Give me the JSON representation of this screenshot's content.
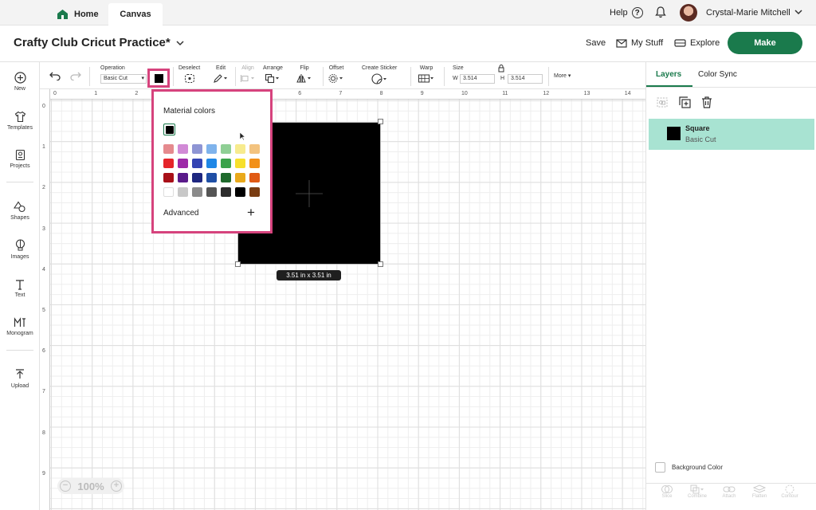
{
  "topbar": {
    "home_label": "Home",
    "canvas_label": "Canvas",
    "help_label": "Help",
    "user_name": "Crystal-Marie Mitchell"
  },
  "header": {
    "project_title": "Crafty Club Cricut Practice*",
    "save_label": "Save",
    "my_stuff_label": "My Stuff",
    "explore_label": "Explore",
    "make_label": "Make"
  },
  "leftbar": {
    "new": "New",
    "templates": "Templates",
    "projects": "Projects",
    "shapes": "Shapes",
    "images": "Images",
    "text": "Text",
    "monogram": "Monogram",
    "upload": "Upload"
  },
  "toolbar": {
    "operation_label": "Operation",
    "operation_value": "Basic Cut",
    "deselect": "Deselect",
    "edit": "Edit",
    "align": "Align",
    "arrange": "Arrange",
    "flip": "Flip",
    "offset": "Offset",
    "create_sticker": "Create Sticker",
    "warp": "Warp",
    "size": "Size",
    "w_label": "W",
    "w_value": "3.514",
    "h_label": "H",
    "h_value": "3.514",
    "more": "More"
  },
  "ruler": {
    "h": [
      "0",
      "1",
      "2",
      "3",
      "4",
      "5",
      "6",
      "7",
      "8",
      "9",
      "10",
      "11",
      "12",
      "13",
      "14"
    ],
    "v": [
      "0",
      "1",
      "2",
      "3",
      "4",
      "5",
      "6",
      "7",
      "8",
      "9"
    ]
  },
  "canvas": {
    "dimension_label": "3.51  in x 3.51  in",
    "zoom": "100%"
  },
  "color_popup": {
    "title": "Material colors",
    "advanced": "Advanced",
    "rows": [
      [
        "#e58a8e",
        "#d18ad6",
        "#8e95d4",
        "#7fb3ec",
        "#8fcf95",
        "#f7eb8e",
        "#f3c37f"
      ],
      [
        "#e5242a",
        "#9d2aa8",
        "#3444b3",
        "#1f87e6",
        "#3aa24a",
        "#f7e02b",
        "#f29019"
      ],
      [
        "#a81018",
        "#5a1a8a",
        "#1e2780",
        "#1f4fa5",
        "#1f6a2c",
        "#e9a91b",
        "#e05a14"
      ],
      [
        "#ffffff",
        "#c8c8c8",
        "#8b8b8b",
        "#555555",
        "#2c2c2c",
        "#000000",
        "#7a3d12"
      ]
    ],
    "selected": "#000000"
  },
  "rightpanel": {
    "tab_layers": "Layers",
    "tab_color_sync": "Color Sync",
    "layer_name": "Square",
    "layer_sub": "Basic Cut",
    "background_color": "Background Color",
    "bottom": [
      "Slice",
      "Combine",
      "Attach",
      "Flatten",
      "Contour"
    ]
  },
  "colors": {
    "accent": "#1a7a4c",
    "highlight": "#d6437d",
    "layer_bg": "#a8e3d2"
  }
}
